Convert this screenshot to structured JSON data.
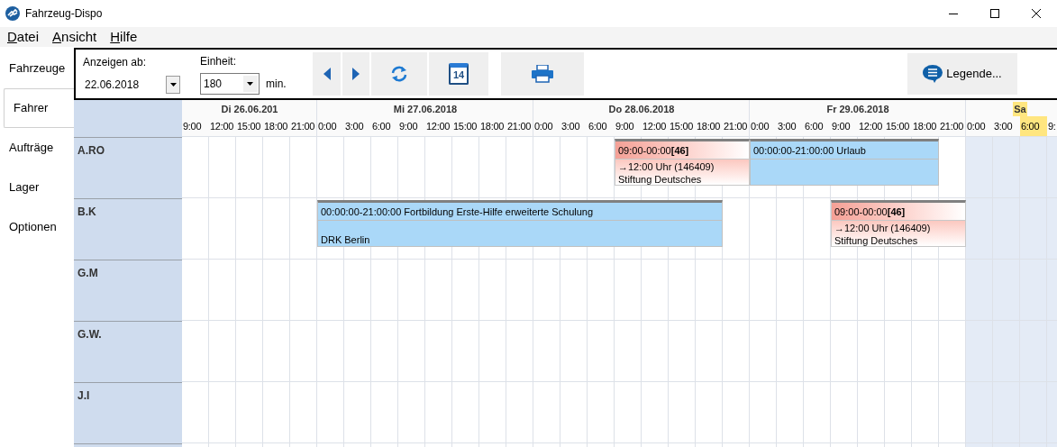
{
  "window": {
    "title": "Fahrzeug-Dispo"
  },
  "menu": [
    "Datei",
    "Ansicht",
    "Hilfe"
  ],
  "sidebar": [
    {
      "label": "Fahrzeuge",
      "selected": false
    },
    {
      "label": "Fahrer",
      "selected": true
    },
    {
      "label": "Aufträge",
      "selected": false
    },
    {
      "label": "Lager",
      "selected": false
    },
    {
      "label": "Optionen",
      "selected": false
    }
  ],
  "toolbar": {
    "date_label": "Anzeigen ab:",
    "date_value": "22.06.2018",
    "unit_label": "Einheit:",
    "unit_value": "180",
    "unit_suffix": "min.",
    "calendar_day": "14",
    "legend_button": "Legende..."
  },
  "days": [
    {
      "label": "Di 26.06.201",
      "weekend": false,
      "times": [
        {
          "label": "9:00",
          "now": false
        },
        {
          "label": "12:00",
          "now": false
        },
        {
          "label": "15:00",
          "now": false
        },
        {
          "label": "18:00",
          "now": false
        },
        {
          "label": "21:00",
          "now": false
        }
      ]
    },
    {
      "label": "Mi 27.06.2018",
      "weekend": false,
      "times": [
        {
          "label": "0:00",
          "now": false
        },
        {
          "label": "3:00",
          "now": false
        },
        {
          "label": "6:00",
          "now": false
        },
        {
          "label": "9:00",
          "now": false
        },
        {
          "label": "12:00",
          "now": false
        },
        {
          "label": "15:00",
          "now": false
        },
        {
          "label": "18:00",
          "now": false
        },
        {
          "label": "21:00",
          "now": false
        }
      ]
    },
    {
      "label": "Do 28.06.2018",
      "weekend": false,
      "times": [
        {
          "label": "0:00",
          "now": false
        },
        {
          "label": "3:00",
          "now": false
        },
        {
          "label": "6:00",
          "now": false
        },
        {
          "label": "9:00",
          "now": false
        },
        {
          "label": "12:00",
          "now": false
        },
        {
          "label": "15:00",
          "now": false
        },
        {
          "label": "18:00",
          "now": false
        },
        {
          "label": "21:00",
          "now": false
        }
      ]
    },
    {
      "label": "Fr 29.06.2018",
      "weekend": false,
      "times": [
        {
          "label": "0:00",
          "now": false
        },
        {
          "label": "3:00",
          "now": false
        },
        {
          "label": "6:00",
          "now": false
        },
        {
          "label": "9:00",
          "now": false
        },
        {
          "label": "12:00",
          "now": false
        },
        {
          "label": "15:00",
          "now": false
        },
        {
          "label": "18:00",
          "now": false
        },
        {
          "label": "21:00",
          "now": false
        }
      ]
    },
    {
      "label": "Sa",
      "weekend": true,
      "times": [
        {
          "label": "0:00",
          "now": false
        },
        {
          "label": "3:00",
          "now": false
        },
        {
          "label": "6:00",
          "now": true
        },
        {
          "label": "9:",
          "now": false
        }
      ]
    }
  ],
  "rows": [
    {
      "name": "A.RO",
      "events": [
        {
          "kind": "order",
          "title": "09:00-00:00**[46]**",
          "lines": [
            "→12:00 Uhr (146409)",
            "Stiftung Deutsches"
          ]
        },
        {
          "kind": "absence",
          "title": "00:00:00-21:00:00 Urlaub"
        }
      ]
    },
    {
      "name": "B.K",
      "events": [
        {
          "kind": "absence",
          "title": "00:00:00-21:00:00 Fortbildung Erste-Hilfe erweiterte Schulung",
          "lines": [
            "DRK Berlin"
          ]
        },
        {
          "kind": "order",
          "title": "09:00-00:00**[46]**",
          "lines": [
            "→12:00 Uhr (146409)",
            "Stiftung Deutsches"
          ]
        }
      ]
    },
    {
      "name": "G.M",
      "events": []
    },
    {
      "name": "G.W.",
      "events": []
    },
    {
      "name": "J.I",
      "events": []
    }
  ]
}
